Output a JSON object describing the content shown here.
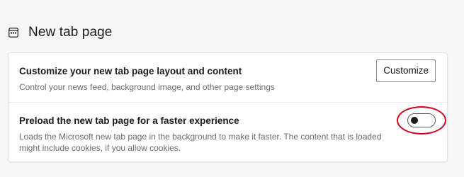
{
  "section": {
    "title": "New tab page",
    "icon": "new-tab-page-icon"
  },
  "settings": {
    "customize_layout": {
      "title": "Customize your new tab page layout and content",
      "description": "Control your news feed, background image, and other page settings",
      "button_label": "Customize"
    },
    "preload": {
      "title": "Preload the new tab page for a faster experience",
      "description": "Loads the Microsoft new tab page in the background to make it faster. The content that is loaded might include cookies, if you allow cookies.",
      "toggle_state": "off"
    }
  },
  "colors": {
    "annotation": "#d0021b",
    "background": "#f7f7f7",
    "card": "#ffffff"
  }
}
